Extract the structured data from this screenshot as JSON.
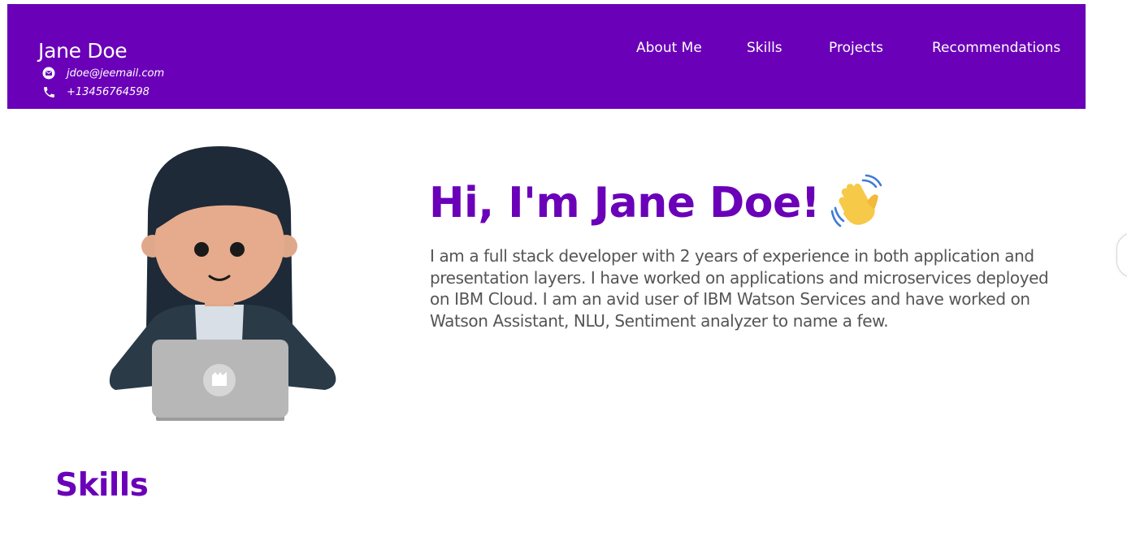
{
  "header": {
    "name": "Jane Doe",
    "email": "jdoe@jeemail.com",
    "phone": "+13456764598",
    "email_icon": "envelope-icon",
    "phone_icon": "phone-icon"
  },
  "nav": {
    "items": [
      {
        "label": "About Me"
      },
      {
        "label": "Skills"
      },
      {
        "label": "Projects"
      },
      {
        "label": "Recommendations"
      }
    ]
  },
  "hero": {
    "title": "Hi, I'm Jane Doe!",
    "wave_icon": "waving-hand-icon",
    "description": "I am a full stack developer with 2 years of experience in both application and presentation layers. I have worked on applications and microservices deployed on IBM Cloud. I am an avid user of IBM Watson Services and have worked on Watson Assistant, NLU, Sentiment analyzer to name a few.",
    "avatar_icon": "developer-avatar-illustration"
  },
  "skills": {
    "heading": "Skills"
  },
  "colors": {
    "brand": "#6a00b8",
    "text_muted": "#555555",
    "header_text": "#ffffff"
  }
}
